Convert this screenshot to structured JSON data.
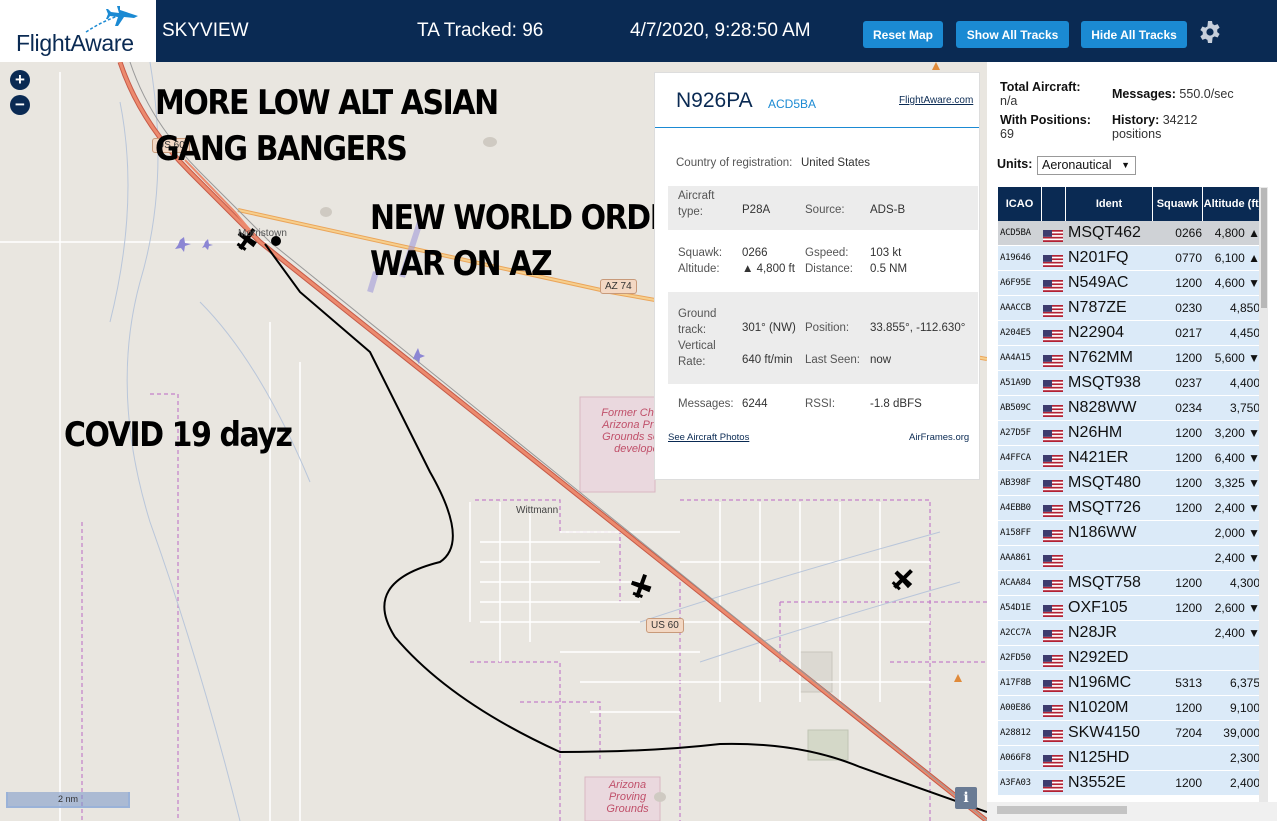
{
  "header": {
    "logo_text": "FlightAware",
    "app_title": "SKYVIEW",
    "tracked": "TA Tracked: 96",
    "datetime": "4/7/2020, 9:28:50 AM",
    "reset_map": "Reset Map",
    "show_all_tracks": "Show All Tracks",
    "hide_all_tracks": "Hide All Tracks"
  },
  "map": {
    "zoom_in": "+",
    "zoom_out": "−",
    "overlay_text_1": "MORE LOW ALT ASIAN GANG BANGERS",
    "overlay_text_2": "NEW WORLD ORDER WAR ON AZ",
    "overlay_text_3": "COVID 19 dayz",
    "road_us60_top": "US 60",
    "road_az74": "AZ 74",
    "road_us60_bottom": "US 60",
    "town_morristown": "Morristown",
    "town_wittmann": "Wittmann",
    "poi_chrysler": "Former Chrysler Arizona Proving Grounds sold to developers",
    "poi_proving": "Arizona Proving Grounds",
    "scale_label": "2 nm",
    "info_button": "i"
  },
  "selected": {
    "callsign": "N926PA",
    "hex": "ACD5BA",
    "fa_link": "FlightAware.com",
    "country_label": "Country of registration:",
    "country": "United States",
    "aircraft_type_label": "Aircraft type:",
    "aircraft_type": "P28A",
    "source_label": "Source:",
    "source": "ADS-B",
    "squawk_label": "Squawk:",
    "squawk": "0266",
    "altitude_label": "Altitude:",
    "altitude": "▲ 4,800 ft",
    "gspeed_label": "Gspeed:",
    "gspeed": "103 kt",
    "distance_label": "Distance:",
    "distance": "0.5 NM",
    "ground_track_label": "Ground track:",
    "ground_track": "301° (NW)",
    "vertical_rate_label": "Vertical Rate:",
    "vertical_rate": "640 ft/min",
    "position_label": "Position:",
    "position": "33.855°, -112.630°",
    "last_seen_label": "Last Seen:",
    "last_seen": "now",
    "messages_label": "Messages:",
    "messages": "6244",
    "rssi_label": "RSSI:",
    "rssi": "-1.8 dBFS",
    "photos_link": "See Aircraft Photos",
    "airframes_link": "AirFrames.org"
  },
  "stats": {
    "total_label": "Total Aircraft:",
    "total": "n/a",
    "with_pos_label": "With Positions:",
    "with_pos": "69",
    "messages_label": "Messages:",
    "messages": "550.0/sec",
    "history_label": "History:",
    "history": "34212",
    "history_unit": "positions",
    "units_label": "Units:",
    "units_value": "Aeronautical"
  },
  "table": {
    "headers": {
      "icao": "ICAO",
      "ident": "Ident",
      "squawk": "Squawk",
      "altitude": "Altitude (ft)"
    },
    "rows": [
      {
        "icao": "ACD5BA",
        "ident": "MSQT462",
        "squawk": "0266",
        "alt": "4,800 ▲"
      },
      {
        "icao": "A19646",
        "ident": "N201FQ",
        "squawk": "0770",
        "alt": "6,100 ▲"
      },
      {
        "icao": "A6F95E",
        "ident": "N549AC",
        "squawk": "1200",
        "alt": "4,600 ▼"
      },
      {
        "icao": "AAACCB",
        "ident": "N787ZE",
        "squawk": "0230",
        "alt": "4,850"
      },
      {
        "icao": "A204E5",
        "ident": "N22904",
        "squawk": "0217",
        "alt": "4,450"
      },
      {
        "icao": "AA4A15",
        "ident": "N762MM",
        "squawk": "1200",
        "alt": "5,600 ▼"
      },
      {
        "icao": "A51A9D",
        "ident": "MSQT938",
        "squawk": "0237",
        "alt": "4,400"
      },
      {
        "icao": "AB509C",
        "ident": "N828WW",
        "squawk": "0234",
        "alt": "3,750"
      },
      {
        "icao": "A27D5F",
        "ident": "N26HM",
        "squawk": "1200",
        "alt": "3,200 ▼"
      },
      {
        "icao": "A4FFCA",
        "ident": "N421ER",
        "squawk": "1200",
        "alt": "6,400 ▼"
      },
      {
        "icao": "AB398F",
        "ident": "MSQT480",
        "squawk": "1200",
        "alt": "3,325 ▼"
      },
      {
        "icao": "A4EBB0",
        "ident": "MSQT726",
        "squawk": "1200",
        "alt": "2,400 ▼"
      },
      {
        "icao": "A158FF",
        "ident": "N186WW",
        "squawk": "",
        "alt": "2,000 ▼"
      },
      {
        "icao": "AAA861",
        "ident": "",
        "squawk": "",
        "alt": "2,400 ▼"
      },
      {
        "icao": "ACAA84",
        "ident": "MSQT758",
        "squawk": "1200",
        "alt": "4,300"
      },
      {
        "icao": "A54D1E",
        "ident": "OXF105",
        "squawk": "1200",
        "alt": "2,600 ▼"
      },
      {
        "icao": "A2CC7A",
        "ident": "N28JR",
        "squawk": "",
        "alt": "2,400 ▼"
      },
      {
        "icao": "A2FD50",
        "ident": "N292ED",
        "squawk": "",
        "alt": ""
      },
      {
        "icao": "A17F8B",
        "ident": "N196MC",
        "squawk": "5313",
        "alt": "6,375"
      },
      {
        "icao": "A00E86",
        "ident": "N1020M",
        "squawk": "1200",
        "alt": "9,100"
      },
      {
        "icao": "A28812",
        "ident": "SKW4150",
        "squawk": "7204",
        "alt": "39,000"
      },
      {
        "icao": "A066F8",
        "ident": "N125HD",
        "squawk": "",
        "alt": "2,300"
      },
      {
        "icao": "A3FA03",
        "ident": "N3552E",
        "squawk": "1200",
        "alt": "2,400"
      }
    ]
  },
  "colors": {
    "header_bg": "#0a2a53",
    "button_bg": "#1b8ad3",
    "row_bg": "#dbeaf8",
    "track_line": "#000000",
    "highway": "#e0705a"
  }
}
